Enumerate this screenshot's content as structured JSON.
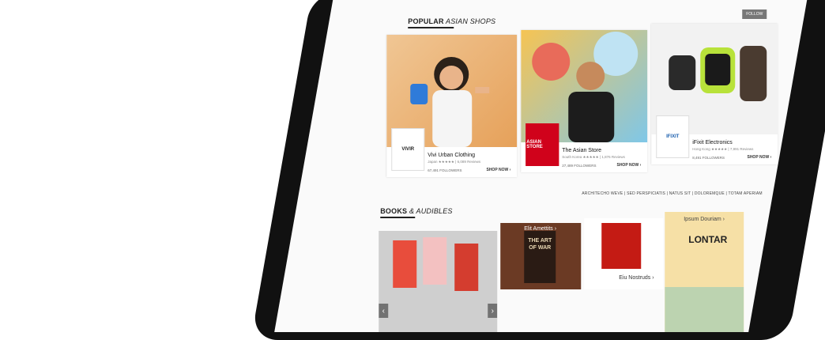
{
  "popular": {
    "title_bold": "POPULAR",
    "title_rest": " ASIAN SHOPS",
    "follow_label": "FOLLOW",
    "shops": [
      {
        "name": "Vivi Urban Clothing",
        "meta": "Japan ★★★★★ | 6,089 Reviews",
        "followers": "67,491 FOLLOWERS",
        "shop_now": "SHOP NOW ›",
        "logo": "VIVIR"
      },
      {
        "name": "The Asian Store",
        "meta": "South Korea ★★★★★ | 1,876 Reviews",
        "followers": "27,489 FOLLOWERS",
        "shop_now": "SHOP NOW ›",
        "logo": "ASIAN STORE"
      },
      {
        "name": "iFixit Electronics",
        "meta": "Hong Kong ★★★★★ | 7,991 Reviews",
        "followers": "8,491 FOLLOWERS",
        "shop_now": "SHOP NOW ›",
        "logo": "IFIXIT"
      }
    ]
  },
  "books": {
    "title_bold": "BOOKS",
    "title_rest": " & AUDIBLES",
    "links": "ARCHITECHO WEVE  |  SED PERSPICIATIS  |  NATUS SIT  |  DOLOREMQUE  |  TOTAM APERIAM",
    "tiles": [
      {
        "label": "Elit Amettits ›"
      },
      {
        "label": "Eiu Nostruds ›"
      },
      {
        "label": "Ipsum Douriam ›"
      }
    ],
    "art_title": "THE ART OF WAR",
    "lontar_title": "LONTAR"
  },
  "colors": {
    "accent": "#d0021b",
    "star": "#f5a623",
    "book_yellow": "#f6e0a6"
  }
}
